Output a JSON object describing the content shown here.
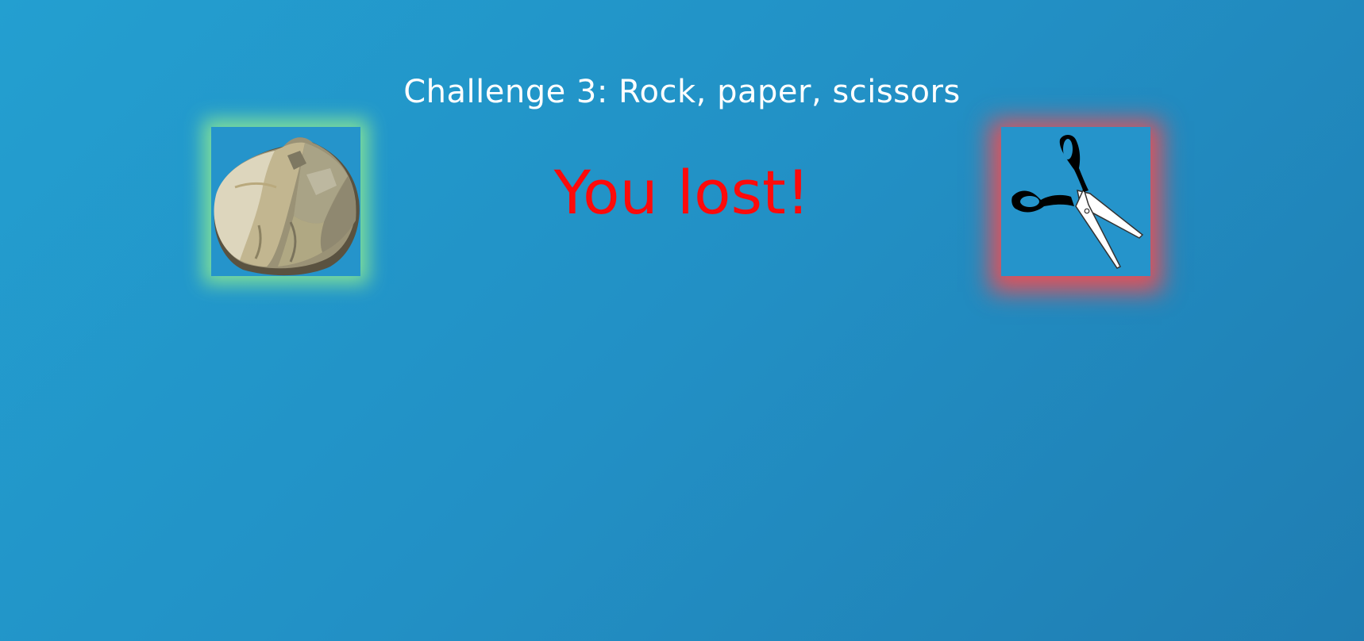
{
  "game": {
    "title": "Challenge 3: Rock, paper, scissors",
    "result_text": "You lost!",
    "result_color": "#ff0a0a"
  },
  "player_choice": {
    "icon": "rock-icon",
    "glow_color": "#7fdf9a"
  },
  "bot_choice": {
    "icon": "scissors-icon",
    "glow_color": "#e0525a"
  }
}
